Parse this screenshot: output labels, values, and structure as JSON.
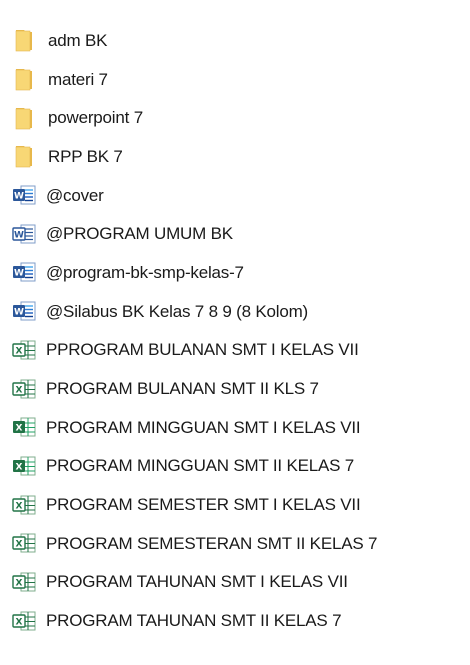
{
  "explorer": {
    "items": [
      {
        "name": "adm BK",
        "type": "folder",
        "icon": "folder-icon"
      },
      {
        "name": "materi 7",
        "type": "folder",
        "icon": "folder-icon"
      },
      {
        "name": "powerpoint 7",
        "type": "folder",
        "icon": "folder-icon"
      },
      {
        "name": "RPP BK 7",
        "type": "folder",
        "icon": "folder-icon"
      },
      {
        "name": "@cover",
        "type": "word",
        "icon": "word-document-icon"
      },
      {
        "name": "@PROGRAM UMUM BK",
        "type": "word-legacy",
        "icon": "word-legacy-document-icon"
      },
      {
        "name": "@program-bk-smp-kelas-7",
        "type": "word",
        "icon": "word-document-icon"
      },
      {
        "name": "@Silabus BK Kelas 7 8 9 (8 Kolom)",
        "type": "word",
        "icon": "word-document-icon"
      },
      {
        "name": "PPROGRAM BULANAN SMT I KELAS VII",
        "type": "excel-legacy",
        "icon": "excel-legacy-document-icon"
      },
      {
        "name": "PROGRAM BULANAN SMT II KLS 7",
        "type": "excel-legacy",
        "icon": "excel-legacy-document-icon"
      },
      {
        "name": "PROGRAM MINGGUAN SMT I KELAS VII",
        "type": "excel",
        "icon": "excel-document-icon"
      },
      {
        "name": "PROGRAM MINGGUAN SMT II KELAS 7",
        "type": "excel",
        "icon": "excel-document-icon"
      },
      {
        "name": "PROGRAM SEMESTER SMT I KELAS VII",
        "type": "excel-legacy",
        "icon": "excel-legacy-document-icon"
      },
      {
        "name": "PROGRAM SEMESTERAN SMT II KELAS 7",
        "type": "excel-legacy",
        "icon": "excel-legacy-document-icon"
      },
      {
        "name": "PROGRAM TAHUNAN SMT I KELAS VII",
        "type": "excel-legacy",
        "icon": "excel-legacy-document-icon"
      },
      {
        "name": "PROGRAM TAHUNAN SMT II KELAS 7",
        "type": "excel-legacy",
        "icon": "excel-legacy-document-icon"
      }
    ]
  },
  "colors": {
    "folder": "#F8D775",
    "folder_dark": "#E8B84A",
    "word": "#2B579A",
    "excel": "#217346"
  }
}
